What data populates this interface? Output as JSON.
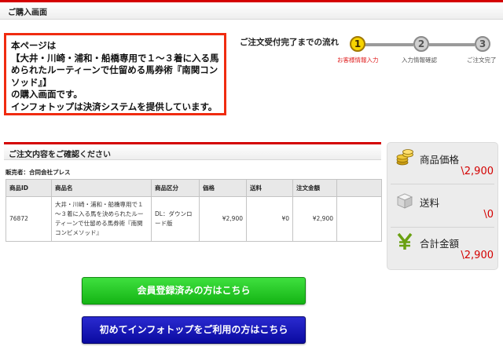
{
  "header": {
    "title": "ご購入画面"
  },
  "notice": {
    "lines": [
      "本ページは",
      "【大井・川崎・浦和・船橋専用で１～３着に入る馬を決",
      "められたルーティーンで仕留める馬券術『南関コンビメ",
      "ソッド』】",
      "の購入画面です。",
      "インフォトップは決済システムを提供しています。"
    ]
  },
  "flow": {
    "title": "ご注文受付完了までの流れ",
    "steps": [
      {
        "num": "1",
        "label": "お客様情報入力",
        "active": true
      },
      {
        "num": "2",
        "label": "入力情報確認",
        "active": false
      },
      {
        "num": "3",
        "label": "ご注文完了",
        "active": false
      }
    ]
  },
  "order": {
    "title": "ご注文内容をご確認ください",
    "seller": "販売者：合同会社プレス",
    "columns": [
      "商品ID",
      "商品名",
      "商品区分",
      "価格",
      "送料",
      "注文金額",
      ""
    ],
    "rows": [
      {
        "id": "76872",
        "name": "大井・川崎・浦和・船橋専用で１～３着に入る馬を決められたルーティーンで仕留める馬券術『南関コンビメソッド』",
        "type": "DL：ダウンロード版",
        "price": "¥2,900",
        "shipping": "¥0",
        "total": "¥2,900"
      }
    ]
  },
  "summary": {
    "items": [
      {
        "label": "商品価格",
        "value": "\\2,900",
        "icon": "coins-icon"
      },
      {
        "label": "送料",
        "value": "\\0",
        "icon": "box-icon"
      },
      {
        "label": "合計金額",
        "value": "\\2,900",
        "icon": "yen-icon"
      }
    ]
  },
  "buttons": {
    "member": "会員登録済みの方はこちら",
    "first_time": "初めてインフォトップをご利用の方はこちら"
  },
  "colors": {
    "accent_red": "#d40000",
    "notice_border": "#f02b10",
    "step_active": "#f7d400",
    "button_green": "#14b414",
    "button_blue": "#0a0aa0"
  }
}
